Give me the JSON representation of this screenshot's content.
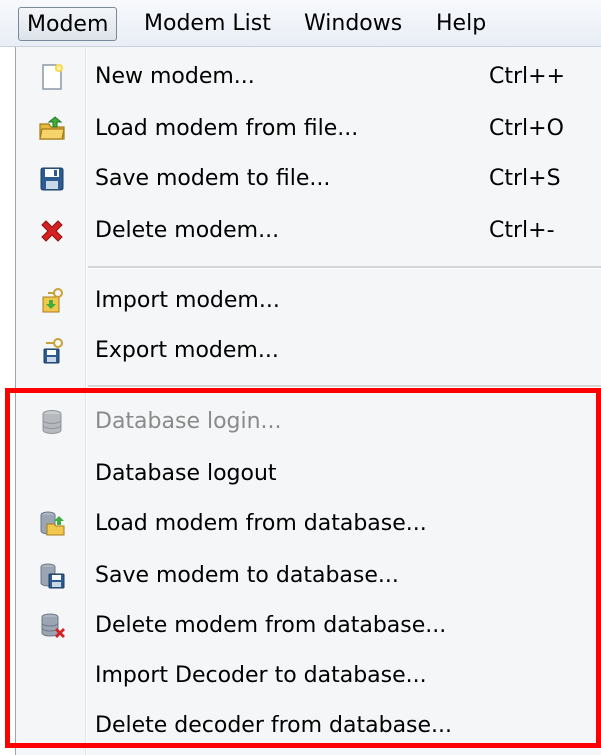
{
  "menubar": {
    "items": [
      {
        "label": "Modem"
      },
      {
        "label": "Modem List"
      },
      {
        "label": "Windows"
      },
      {
        "label": "Help"
      }
    ]
  },
  "menu": {
    "items": [
      {
        "label": "New modem...",
        "shortcut": "Ctrl++",
        "icon": "new-document-icon"
      },
      {
        "label": "Load modem from file...",
        "shortcut": "Ctrl+O",
        "icon": "open-folder-icon"
      },
      {
        "label": "Save modem to file...",
        "shortcut": "Ctrl+S",
        "icon": "floppy-disk-icon"
      },
      {
        "label": "Delete modem...",
        "shortcut": "Ctrl+-",
        "icon": "red-x-icon"
      },
      {
        "label": "Import modem...",
        "icon": "import-key-icon"
      },
      {
        "label": "Export modem...",
        "icon": "export-key-icon"
      },
      {
        "label": "Database login...",
        "icon": "database-icon",
        "disabled": true
      },
      {
        "label": "Database logout"
      },
      {
        "label": "Load modem from database...",
        "icon": "database-load-icon"
      },
      {
        "label": "Save modem to database...",
        "icon": "database-save-icon"
      },
      {
        "label": "Delete modem from database...",
        "icon": "database-delete-icon"
      },
      {
        "label": "Import Decoder to database..."
      },
      {
        "label": "Delete decoder from database..."
      }
    ]
  },
  "colors": {
    "highlight_border": "#ff0000",
    "disabled_text": "#8a8a8a"
  }
}
